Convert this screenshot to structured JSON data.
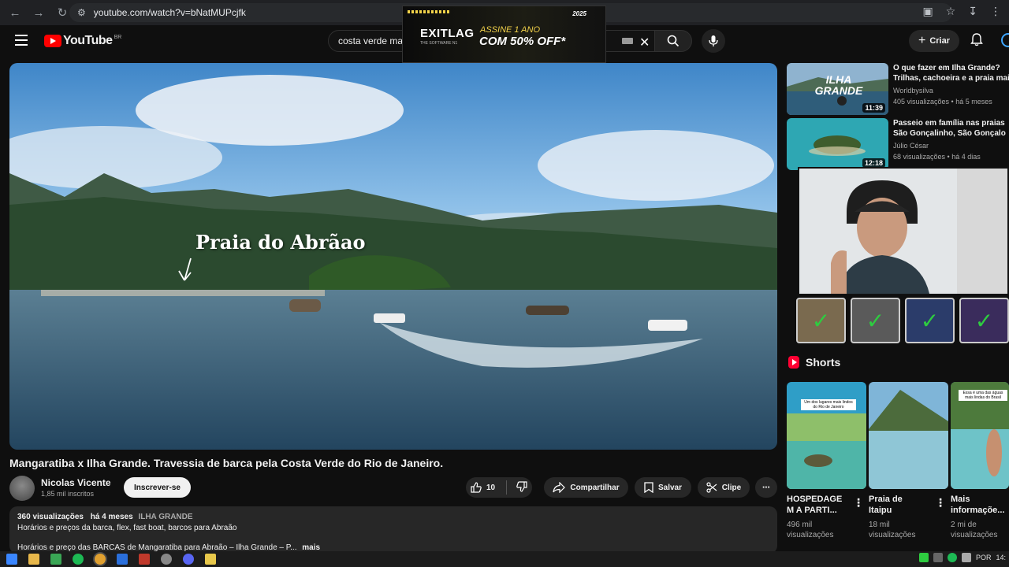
{
  "browser": {
    "url": "youtube.com/watch?v=bNatMUPcjfk"
  },
  "ad": {
    "brand": "EXITLAG",
    "brand_sub": "THE SOFTWARE N1",
    "line1": "ASSINE 1 ANO",
    "line2": "COM 50% OFF*",
    "badge": "2025"
  },
  "header": {
    "logo_text": "YouTube",
    "country_code": "BR",
    "search_query": "costa verde ma",
    "create_label": "Criar"
  },
  "player": {
    "overlay_label": "Praia do Abrãao"
  },
  "video": {
    "title": "Mangaratiba x Ilha Grande. Travessia de barca pela Costa Verde do Rio de Janeiro.",
    "channel": "Nicolas Vicente",
    "subscribers": "1,85 mil inscritos",
    "subscribe_label": "Inscrever-se",
    "likes": "10",
    "share_label": "Compartilhar",
    "save_label": "Salvar",
    "clip_label": "Clipe"
  },
  "description": {
    "views": "360 visualizações",
    "age": "há 4 meses",
    "tag": "ILHA GRANDE",
    "line1": "Horários e preços da barca, flex, fast boat, barcos para Abraão",
    "line2": "Horários e preço das BARCAS de Mangaratiba para Abraão – Ilha Grande – P...",
    "more": "mais"
  },
  "recommendations": [
    {
      "title_line1": "O que fazer em  Ilha Grande?",
      "title_line2": "Trilhas, cachoeira e a praia mai",
      "channel": "Worldbysilva",
      "stats": "405 visualizações • há 5 meses",
      "duration": "11:39",
      "thumb_text": "ILHA GRANDE"
    },
    {
      "title_line1": "Passeio em família nas praias",
      "title_line2": "São Gonçalinho, São Gonçalo",
      "channel": "Júlio César",
      "stats": "68 visualizações • há 4 dias",
      "duration": "12:18"
    }
  ],
  "shorts": {
    "heading": "Shorts",
    "items": [
      {
        "caption_line1": "HOSPEDAGE",
        "caption_line2": "M A PARTI...",
        "views_line1": "496 mil",
        "views_line2": "visualizações",
        "thumb_text": "Um dos lugares mais lindos do Rio de Janeiro"
      },
      {
        "caption_line1": "Praia de",
        "caption_line2": "Itaipu",
        "views_line1": "18 mil",
        "views_line2": "visualizações",
        "thumb_text": ""
      },
      {
        "caption_line1": "Mais",
        "caption_line2": "informaçõe...",
        "views_line1": "2 mi de",
        "views_line2": "visualizações",
        "thumb_text": "Essa é uma das águas mais lindas do Brasil"
      }
    ]
  },
  "taskbar": {
    "lang": "POR",
    "time": "14:"
  },
  "colors": {
    "background": "#0f0f0f",
    "brand_red": "#ff0000",
    "surface": "#272727",
    "ad_accent": "#f3d34a",
    "check_green": "#2ecc40"
  }
}
